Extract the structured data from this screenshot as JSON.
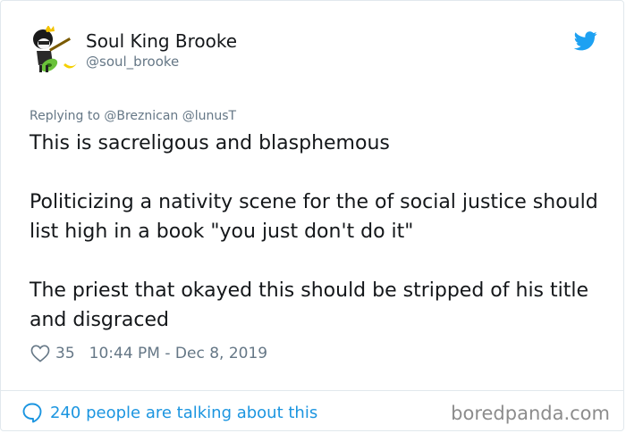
{
  "author": {
    "name": "Soul King Brooke",
    "handle": "@soul_brooke",
    "avatar_icon": "skeleton-guitarist-avatar"
  },
  "reply_context": "Replying to @Breznican @lunusT",
  "tweet": {
    "paragraphs": [
      "This is sacreligous and blasphemous",
      "Politicizing a nativity scene for the of social justice should list high in a book \"you just don't do it\"",
      "The priest that okayed this should be stripped of his title and disgraced"
    ]
  },
  "meta": {
    "likes": "35",
    "timestamp": "10:44 PM - Dec 8, 2019"
  },
  "footer": {
    "talking": "240 people are talking about this",
    "watermark": "boredpanda.com"
  },
  "colors": {
    "accent": "#1b95e0",
    "muted": "#657786",
    "text": "#14171a",
    "border": "#e1e8ed"
  }
}
